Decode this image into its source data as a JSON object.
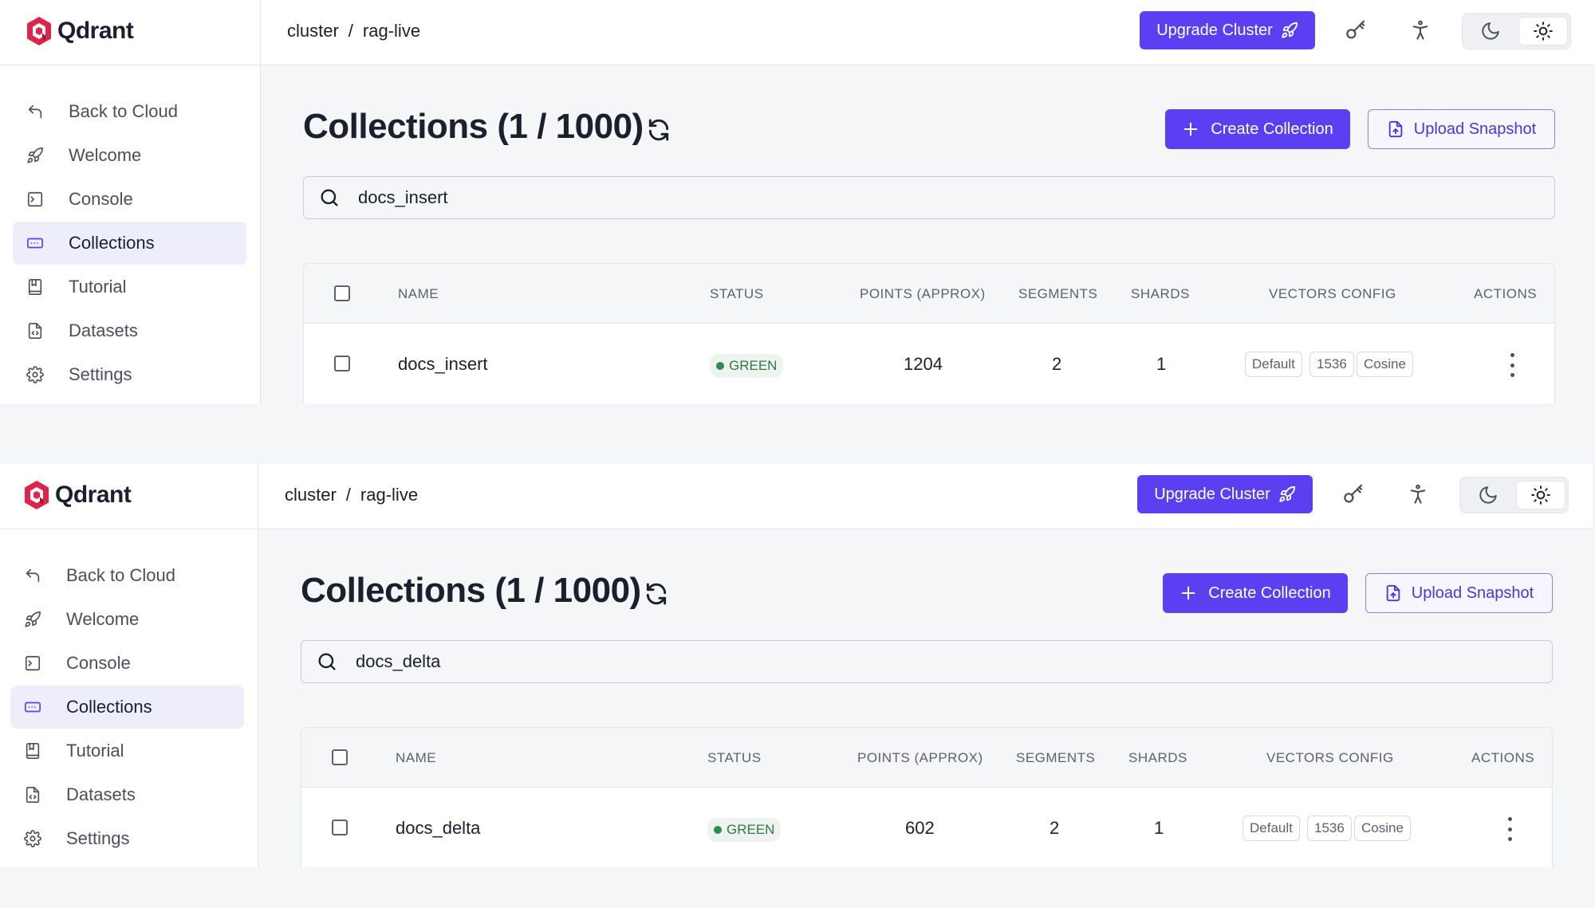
{
  "app": {
    "name": "Qdrant"
  },
  "panels": [
    {
      "breadcrumb": {
        "cluster": "cluster",
        "separator": "/",
        "name": "rag-live"
      },
      "header": {
        "upgrade_label": "Upgrade Cluster"
      },
      "sidebar": {
        "items": [
          {
            "label": "Back to Cloud",
            "icon": "back-arrow-icon"
          },
          {
            "label": "Welcome",
            "icon": "rocket-icon"
          },
          {
            "label": "Console",
            "icon": "terminal-icon"
          },
          {
            "label": "Collections",
            "icon": "collections-icon",
            "active": true
          },
          {
            "label": "Tutorial",
            "icon": "book-icon"
          },
          {
            "label": "Datasets",
            "icon": "dataset-file-icon"
          },
          {
            "label": "Settings",
            "icon": "gear-icon"
          }
        ]
      },
      "main": {
        "title": "Collections (1 / 1000)",
        "create_label": "Create Collection",
        "upload_label": "Upload Snapshot",
        "search_value": "docs_insert",
        "columns": [
          "NAME",
          "STATUS",
          "POINTS (APPROX)",
          "SEGMENTS",
          "SHARDS",
          "VECTORS CONFIG",
          "ACTIONS"
        ],
        "rows": [
          {
            "name": "docs_insert",
            "status": "GREEN",
            "points": "1204",
            "segments": "2",
            "shards": "1",
            "vectors": [
              "Default",
              "1536",
              "Cosine"
            ]
          }
        ]
      }
    },
    {
      "breadcrumb": {
        "cluster": "cluster",
        "separator": "/",
        "name": "rag-live"
      },
      "header": {
        "upgrade_label": "Upgrade Cluster"
      },
      "sidebar": {
        "items": [
          {
            "label": "Back to Cloud",
            "icon": "back-arrow-icon"
          },
          {
            "label": "Welcome",
            "icon": "rocket-icon"
          },
          {
            "label": "Console",
            "icon": "terminal-icon"
          },
          {
            "label": "Collections",
            "icon": "collections-icon",
            "active": true
          },
          {
            "label": "Tutorial",
            "icon": "book-icon"
          },
          {
            "label": "Datasets",
            "icon": "dataset-file-icon"
          },
          {
            "label": "Settings",
            "icon": "gear-icon"
          }
        ]
      },
      "main": {
        "title": "Collections (1 / 1000)",
        "create_label": "Create Collection",
        "upload_label": "Upload Snapshot",
        "search_value": "docs_delta",
        "columns": [
          "NAME",
          "STATUS",
          "POINTS (APPROX)",
          "SEGMENTS",
          "SHARDS",
          "VECTORS CONFIG",
          "ACTIONS"
        ],
        "rows": [
          {
            "name": "docs_delta",
            "status": "GREEN",
            "points": "602",
            "segments": "2",
            "shards": "1",
            "vectors": [
              "Default",
              "1536",
              "Cosine"
            ]
          }
        ]
      }
    }
  ],
  "colors": {
    "accent": "#5b3ff0",
    "status_green": "#2f8a52",
    "brand_red": "#dc244c"
  }
}
